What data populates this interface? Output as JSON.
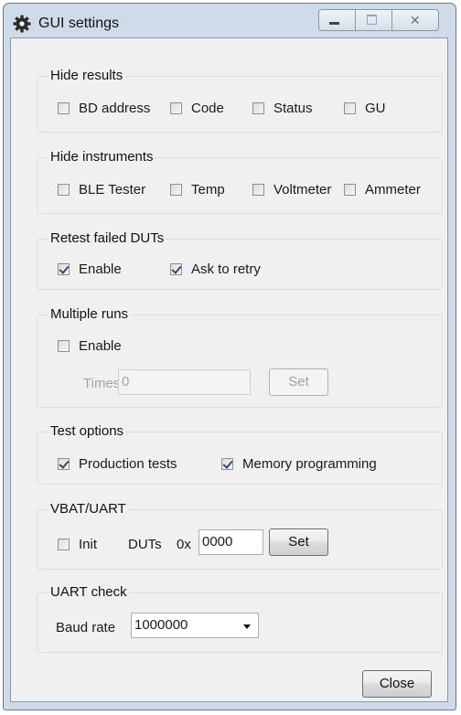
{
  "window": {
    "title": "GUI settings",
    "close_glyph": "✕"
  },
  "hide_results": {
    "title": "Hide results",
    "items": [
      {
        "label": "BD address",
        "checked": false
      },
      {
        "label": "Code",
        "checked": false
      },
      {
        "label": "Status",
        "checked": false
      },
      {
        "label": "GU",
        "checked": false
      }
    ]
  },
  "hide_instruments": {
    "title": "Hide instruments",
    "items": [
      {
        "label": "BLE Tester",
        "checked": false
      },
      {
        "label": "Temp",
        "checked": false
      },
      {
        "label": "Voltmeter",
        "checked": false
      },
      {
        "label": "Ammeter",
        "checked": false
      }
    ]
  },
  "retest": {
    "title": "Retest failed DUTs",
    "enable": {
      "label": "Enable",
      "checked": true
    },
    "ask": {
      "label": "Ask to retry",
      "checked": true
    }
  },
  "multiple_runs": {
    "title": "Multiple runs",
    "enable": {
      "label": "Enable",
      "checked": false
    },
    "times_label": "Times",
    "times_value": "0",
    "set_label": "Set"
  },
  "test_options": {
    "title": "Test options",
    "production": {
      "label": "Production tests",
      "checked": true
    },
    "memory": {
      "label": "Memory programming",
      "checked": true
    }
  },
  "vbat_uart": {
    "title": "VBAT/UART",
    "init": {
      "label": "Init",
      "checked": false
    },
    "duts_label": "DUTs",
    "hex_prefix": "0x",
    "duts_value": "0000",
    "set_label": "Set"
  },
  "uart_check": {
    "title": "UART check",
    "baud_label": "Baud rate",
    "baud_value": "1000000"
  },
  "close_label": "Close",
  "colors": {
    "frame": "#cfdbe8",
    "client": "#f0f0f0",
    "check": "#304a7c"
  }
}
